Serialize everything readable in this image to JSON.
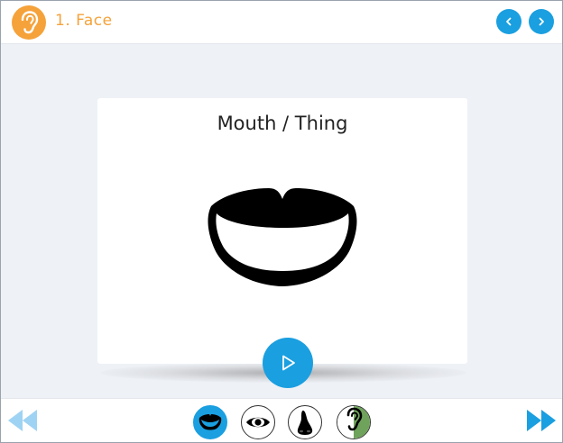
{
  "header": {
    "title": "1. Face",
    "logo_icon": "ear-icon",
    "prev_icon": "chevron-left-icon",
    "next_icon": "chevron-right-icon"
  },
  "card": {
    "title": "Mouth / Thing",
    "image_icon": "mouth-icon",
    "play_icon": "play-icon"
  },
  "bottom": {
    "prev_icon": "double-arrow-left-icon",
    "next_icon": "double-arrow-right-icon",
    "thumbnails": [
      {
        "icon": "mouth-icon",
        "active": true
      },
      {
        "icon": "eye-icon",
        "active": false
      },
      {
        "icon": "nose-icon",
        "active": false
      },
      {
        "icon": "ear-icon",
        "active": false
      }
    ]
  },
  "colors": {
    "accent_blue": "#1a9fe0",
    "accent_orange": "#f5a23a",
    "stage_bg": "#eef1f6"
  }
}
